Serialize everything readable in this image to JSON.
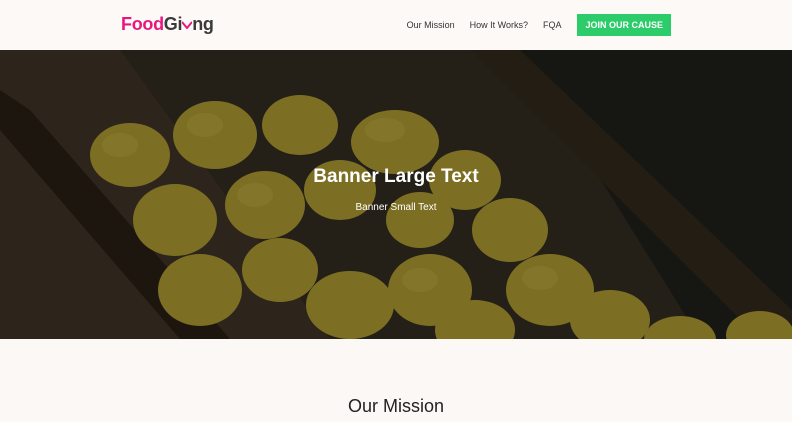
{
  "logo": {
    "part1": "Food",
    "part2": "Gi",
    "part3": "ng"
  },
  "nav": {
    "items": [
      "Our Mission",
      "How It Works?",
      "FQA"
    ],
    "cta": "JOIN OUR CAUSE"
  },
  "banner": {
    "title": "Banner Large Text",
    "subtitle": "Banner Small Text"
  },
  "mission": {
    "title": "Our Mission"
  },
  "colors": {
    "brand_pink": "#e8177f",
    "cta_green": "#2dcc6a"
  }
}
